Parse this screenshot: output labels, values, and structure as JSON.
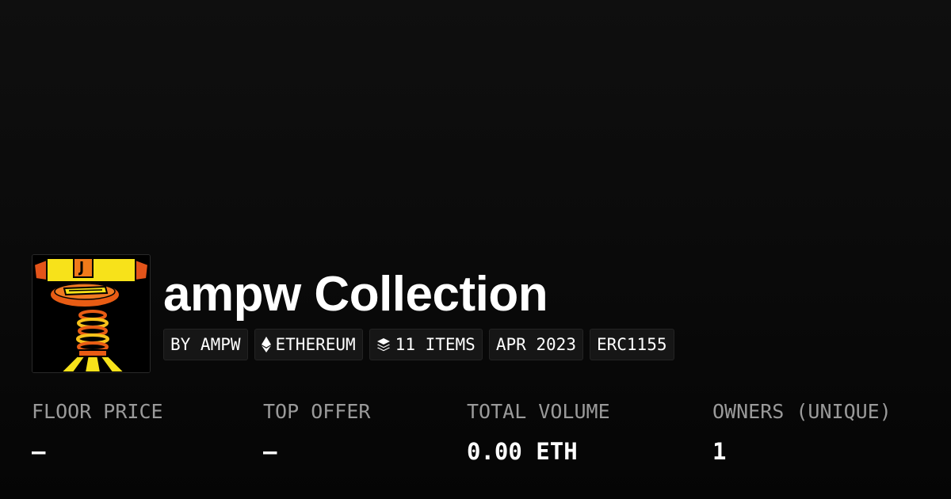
{
  "collection": {
    "title": "ampw Collection",
    "avatar_icon": "collection-avatar-artwork"
  },
  "chips": {
    "creator": "BY AMPW",
    "chain": "ETHEREUM",
    "chain_icon": "ethereum-icon",
    "items": "11 ITEMS",
    "items_icon": "layers-icon",
    "date": "APR 2023",
    "standard": "ERC1155"
  },
  "stats": {
    "floor_price": {
      "label": "FLOOR PRICE",
      "value": "—"
    },
    "top_offer": {
      "label": "TOP OFFER",
      "value": "—"
    },
    "total_volume": {
      "label": "TOTAL VOLUME",
      "value": "0.00 ETH"
    },
    "owners": {
      "label": "OWNERS (UNIQUE)",
      "value": "1"
    }
  },
  "colors": {
    "background": "#0b0b0b",
    "label": "#9a9a9a",
    "text": "#ffffff",
    "chip_bg": "#161616"
  }
}
